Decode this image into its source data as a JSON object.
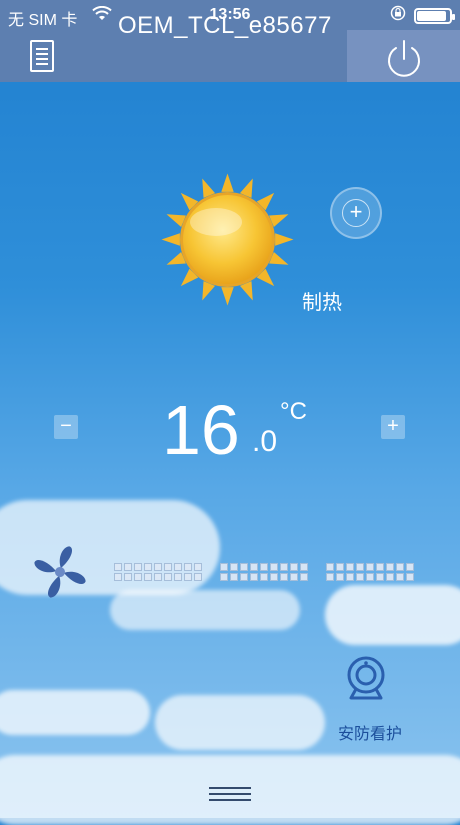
{
  "status_bar": {
    "carrier": "无 SIM 卡",
    "time": "13:56",
    "battery_level": 0.9
  },
  "header": {
    "title": "OEM_TCL_e85677"
  },
  "mode": {
    "label": "制热"
  },
  "temperature": {
    "integer": "16",
    "decimal": ".0",
    "unit": "°C",
    "minus": "−",
    "plus": "+"
  },
  "security": {
    "label": "安防看护"
  }
}
